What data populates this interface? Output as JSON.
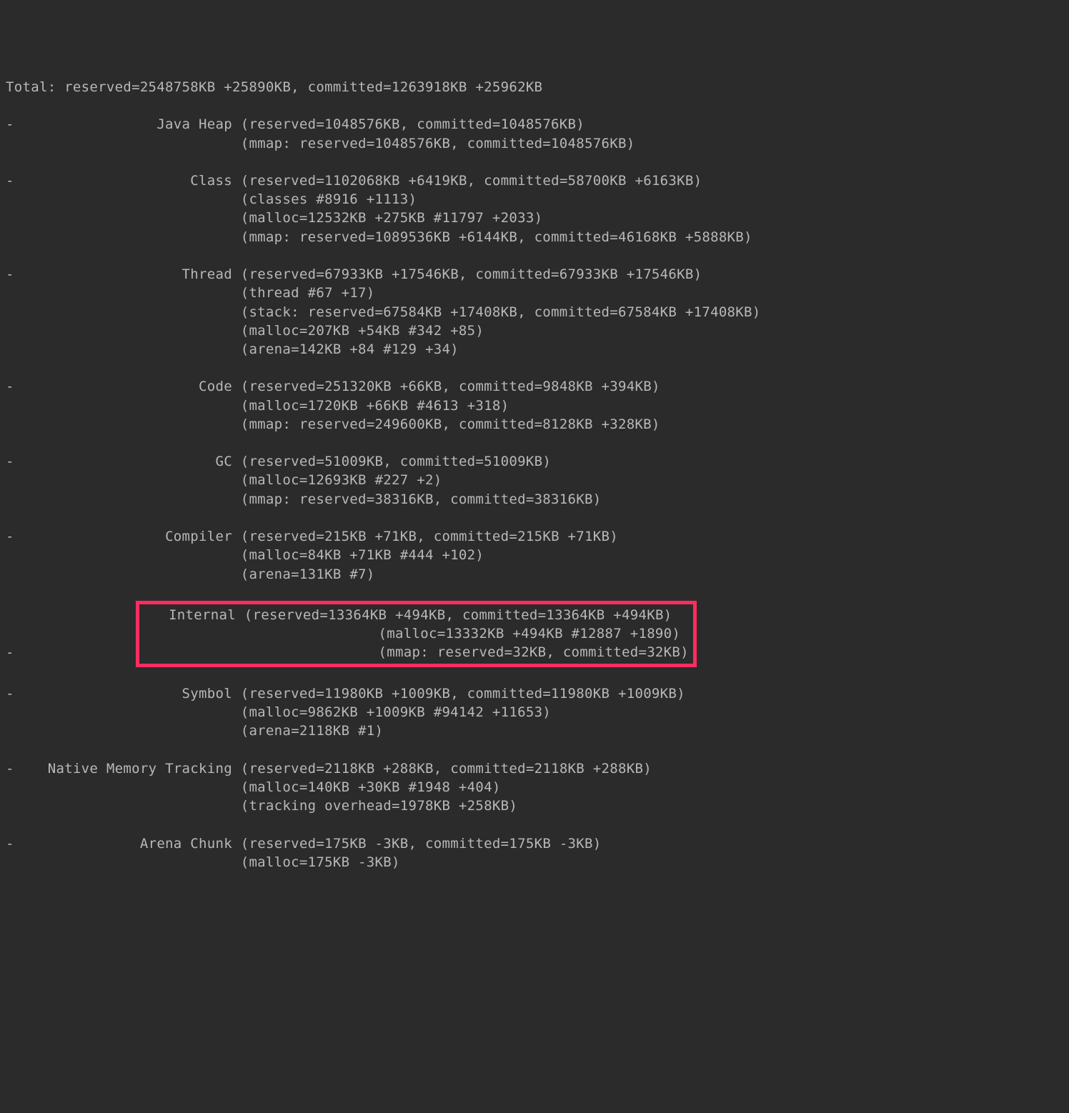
{
  "header": {
    "total_line": "Total: reserved=2548758KB +25890KB, committed=1263918KB +25962KB"
  },
  "sections": {
    "java_heap": {
      "dash": "-",
      "label": "Java Heap",
      "main": "(reserved=1048576KB, committed=1048576KB)",
      "sub1": "(mmap: reserved=1048576KB, committed=1048576KB)"
    },
    "class": {
      "dash": "-",
      "label": "Class",
      "main": "(reserved=1102068KB +6419KB, committed=58700KB +6163KB)",
      "sub1": "(classes #8916 +1113)",
      "sub2": "(malloc=12532KB +275KB #11797 +2033)",
      "sub3": "(mmap: reserved=1089536KB +6144KB, committed=46168KB +5888KB)"
    },
    "thread": {
      "dash": "-",
      "label": "Thread",
      "main": "(reserved=67933KB +17546KB, committed=67933KB +17546KB)",
      "sub1": "(thread #67 +17)",
      "sub2": "(stack: reserved=67584KB +17408KB, committed=67584KB +17408KB)",
      "sub3": "(malloc=207KB +54KB #342 +85)",
      "sub4": "(arena=142KB +84 #129 +34)"
    },
    "code": {
      "dash": "-",
      "label": "Code",
      "main": "(reserved=251320KB +66KB, committed=9848KB +394KB)",
      "sub1": "(malloc=1720KB +66KB #4613 +318)",
      "sub2": "(mmap: reserved=249600KB, committed=8128KB +328KB)"
    },
    "gc": {
      "dash": "-",
      "label": "GC",
      "main": "(reserved=51009KB, committed=51009KB)",
      "sub1": "(malloc=12693KB #227 +2)",
      "sub2": "(mmap: reserved=38316KB, committed=38316KB)"
    },
    "compiler": {
      "dash": "-",
      "label": "Compiler",
      "main": "(reserved=215KB +71KB, committed=215KB +71KB)",
      "sub1": "(malloc=84KB +71KB #444 +102)",
      "sub2": "(arena=131KB #7)"
    },
    "internal": {
      "dash": "-",
      "label": "Internal",
      "main": "(reserved=13364KB +494KB, committed=13364KB +494KB)",
      "sub1": "(malloc=13332KB +494KB #12887 +1890)",
      "sub2": "(mmap: reserved=32KB, committed=32KB)"
    },
    "symbol": {
      "dash": "-",
      "label": "Symbol",
      "main": "(reserved=11980KB +1009KB, committed=11980KB +1009KB)",
      "sub1": "(malloc=9862KB +1009KB #94142 +11653)",
      "sub2": "(arena=2118KB #1)"
    },
    "nmt": {
      "dash": "-",
      "label": "Native Memory Tracking",
      "main": "(reserved=2118KB +288KB, committed=2118KB +288KB)",
      "sub1": "(malloc=140KB +30KB #1948 +404)",
      "sub2": "(tracking overhead=1978KB +258KB)"
    },
    "arena_chunk": {
      "dash": "-",
      "label": "Arena Chunk",
      "main": "(reserved=175KB -3KB, committed=175KB -3KB)",
      "sub1": "(malloc=175KB -3KB)"
    }
  }
}
